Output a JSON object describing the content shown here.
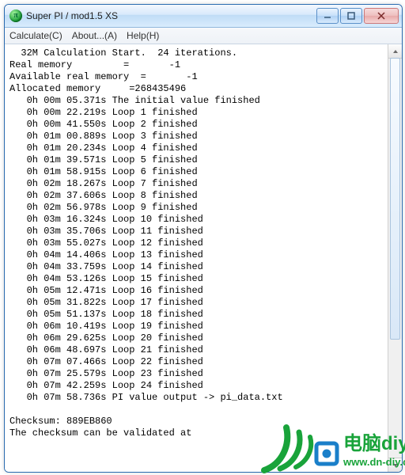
{
  "window": {
    "title": "Super PI / mod1.5 XS"
  },
  "menubar": {
    "calculate": "Calculate(C)",
    "about": "About...(A)",
    "help": "Help(H)"
  },
  "output": {
    "header1": "  32M Calculation Start.  24 iterations.",
    "header2": "Real memory         =       -1",
    "header3": "Available real memory  =       -1",
    "header4": "Allocated memory     =268435496",
    "lines": [
      "   0h 00m 05.371s The initial value finished",
      "   0h 00m 22.219s Loop 1 finished",
      "   0h 00m 41.550s Loop 2 finished",
      "   0h 01m 00.889s Loop 3 finished",
      "   0h 01m 20.234s Loop 4 finished",
      "   0h 01m 39.571s Loop 5 finished",
      "   0h 01m 58.915s Loop 6 finished",
      "   0h 02m 18.267s Loop 7 finished",
      "   0h 02m 37.606s Loop 8 finished",
      "   0h 02m 56.978s Loop 9 finished",
      "   0h 03m 16.324s Loop 10 finished",
      "   0h 03m 35.706s Loop 11 finished",
      "   0h 03m 55.027s Loop 12 finished",
      "   0h 04m 14.406s Loop 13 finished",
      "   0h 04m 33.759s Loop 14 finished",
      "   0h 04m 53.126s Loop 15 finished",
      "   0h 05m 12.471s Loop 16 finished",
      "   0h 05m 31.822s Loop 17 finished",
      "   0h 05m 51.137s Loop 18 finished",
      "   0h 06m 10.419s Loop 19 finished",
      "   0h 06m 29.625s Loop 20 finished",
      "   0h 06m 48.697s Loop 21 finished",
      "   0h 07m 07.466s Loop 22 finished",
      "   0h 07m 25.579s Loop 23 finished",
      "   0h 07m 42.259s Loop 24 finished",
      "   0h 07m 58.736s PI value output -> pi_data.txt",
      "",
      "Checksum: 889EB860",
      "The checksum can be validated at"
    ]
  },
  "watermark": {
    "brand_cn": "电脑diy",
    "url": "www.dn-diy.com"
  },
  "colors": {
    "brand_green": "#19a33a",
    "brand_blue": "#1a7fc9",
    "title_frame": "#d8e9fb"
  }
}
